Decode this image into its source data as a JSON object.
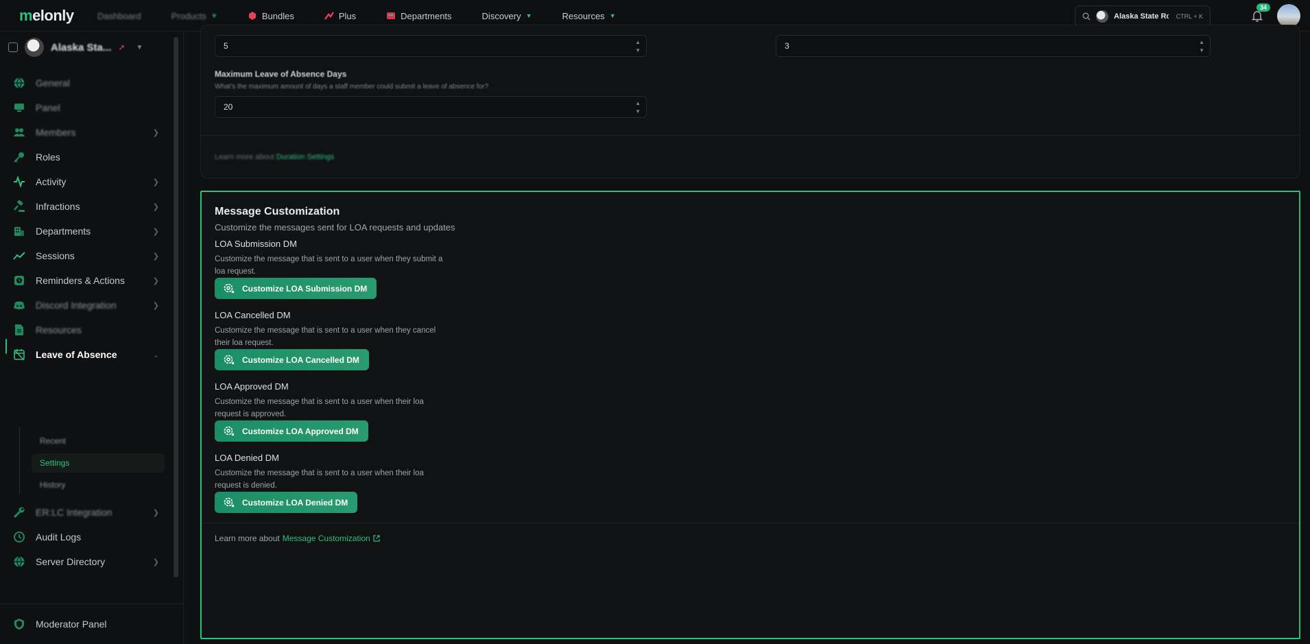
{
  "brand": {
    "logo_text_m": "m",
    "logo_text_rest": "elonly",
    "accent": "#2fc07f",
    "highlight_border": "#22c777"
  },
  "topnav": {
    "items": [
      {
        "label": "Dashboard",
        "blurred": true
      },
      {
        "label": "Products",
        "blurred": true,
        "has_chevron": true
      },
      {
        "label": "Bundles",
        "icon": "bundle-icon"
      },
      {
        "label": "Plus",
        "icon": "plus-icon"
      },
      {
        "label": "Departments",
        "icon": "departments-icon"
      },
      {
        "label": "Discovery",
        "has_chevron": true
      },
      {
        "label": "Resources",
        "has_chevron": true
      }
    ],
    "search": {
      "server_name": "Alaska State Role",
      "shortcut": "CTRL + K"
    },
    "notifications_count": "34"
  },
  "sidebar": {
    "guild_name": "Alaska Sta...",
    "menu": [
      {
        "label": "General",
        "icon": "globe-icon",
        "blurred": true
      },
      {
        "label": "Panel",
        "icon": "monitor-icon",
        "blurred": true
      },
      {
        "label": "Members",
        "icon": "members-icon",
        "blurred": true,
        "chevron": true
      },
      {
        "label": "Roles",
        "icon": "key-icon"
      },
      {
        "label": "Activity",
        "icon": "activity-icon",
        "chevron": true
      },
      {
        "label": "Infractions",
        "icon": "gavel-icon",
        "chevron": true
      },
      {
        "label": "Departments",
        "icon": "building-icon",
        "chevron": true
      },
      {
        "label": "Sessions",
        "icon": "sessions-icon",
        "chevron": true
      },
      {
        "label": "Reminders & Actions",
        "icon": "reminder-icon",
        "chevron": true
      },
      {
        "label": "Discord Integration",
        "icon": "discord-icon",
        "blurred": true,
        "chevron": true
      },
      {
        "label": "Resources",
        "icon": "document-icon",
        "blurred": true
      },
      {
        "label": "Leave of Absence",
        "icon": "calendar-off-icon",
        "active": true,
        "chevron": true
      },
      {
        "label": "ER:LC Integration",
        "icon": "wrench-icon",
        "blurred": true,
        "chevron": true
      },
      {
        "label": "Audit Logs",
        "icon": "history-icon"
      },
      {
        "label": "Server Directory",
        "icon": "globe-icon",
        "chevron": true
      }
    ],
    "submenu": [
      {
        "label": "Recent",
        "blurred": true
      },
      {
        "label": "Settings",
        "active": true
      },
      {
        "label": "History",
        "blurred": true
      }
    ],
    "bottom": {
      "label": "Moderator Panel",
      "icon": "shield-icon"
    }
  },
  "duration_settings": {
    "input_a_value": "5",
    "input_b_value": "3",
    "max_days_title": "Maximum Leave of Absence Days",
    "max_days_desc": "What's the maximum amount of days a staff member could submit a leave of absence for?",
    "max_days_value": "20",
    "learn_prefix": "Learn more about",
    "learn_link": "Duration Settings"
  },
  "message_customization": {
    "title": "Message Customization",
    "subtitle": "Customize the messages sent for LOA requests and updates",
    "blocks": [
      {
        "title": "LOA Submission DM",
        "desc": "Customize the message that is sent to a user when they submit a loa request.",
        "button": "Customize LOA Submission DM"
      },
      {
        "title": "LOA Cancelled DM",
        "desc": "Customize the message that is sent to a user when they cancel their loa request.",
        "button": "Customize LOA Cancelled DM"
      },
      {
        "title": "LOA Approved DM",
        "desc": "Customize the message that is sent to a user when their loa request is approved.",
        "button": "Customize LOA Approved DM"
      },
      {
        "title": "LOA Denied DM",
        "desc": "Customize the message that is sent to a user when their loa request is denied.",
        "button": "Customize LOA Denied DM"
      }
    ],
    "footer_prefix": "Learn more about",
    "footer_link": "Message Customization"
  }
}
